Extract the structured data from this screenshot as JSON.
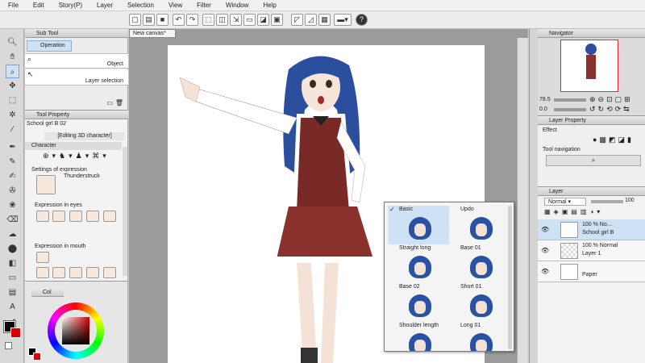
{
  "menu": [
    "File",
    "Edit",
    "Story(P)",
    "Layer",
    "Selection",
    "View",
    "Filter",
    "Window",
    "Help"
  ],
  "canvas_tab": "New canvas*",
  "subtool": {
    "title": "Sub Tool",
    "operation_label": "Operation",
    "items": [
      "Object",
      "Layer selection"
    ]
  },
  "toolprop": {
    "title": "Tool Property",
    "object_name": "School girl B 02",
    "mode": "[Editing 3D character]",
    "character_label": "Character",
    "expression_label": "Settings of expression",
    "expression_value": "Thunderstruck",
    "eyes_label": "Expression in eyes",
    "mouth_label": "Expression in mouth"
  },
  "color_panel": {
    "title": "Col"
  },
  "navigator": {
    "title": "Navigator",
    "zoom_value": "78.5",
    "angle_value": "0.0"
  },
  "layer_property": {
    "title": "Layer Property",
    "effect_label": "Effect",
    "tool_nav_label": "Tool navigation"
  },
  "layer_panel": {
    "title": "Layer",
    "blend_mode": "Normal",
    "opacity": "100",
    "layers": [
      {
        "line1": "100 % No…",
        "line2": "School girl B"
      },
      {
        "line1": "100 % Normal",
        "line2": "Layer 1"
      },
      {
        "line1": "",
        "line2": "Paper"
      }
    ]
  },
  "hairstyle_popup": {
    "items": [
      {
        "label": "Basic",
        "selected": true
      },
      {
        "label": "Updo",
        "selected": false
      },
      {
        "label": "Straight long",
        "selected": false
      },
      {
        "label": "Base 01",
        "selected": false
      },
      {
        "label": "Base 02",
        "selected": false
      },
      {
        "label": "Short 01",
        "selected": false
      },
      {
        "label": "Shoulder length",
        "selected": false
      },
      {
        "label": "Long 01",
        "selected": false
      }
    ]
  },
  "colors": {
    "accent": "#cfe1f5",
    "foreground": "#d90000",
    "background_swatch": "#000000"
  }
}
